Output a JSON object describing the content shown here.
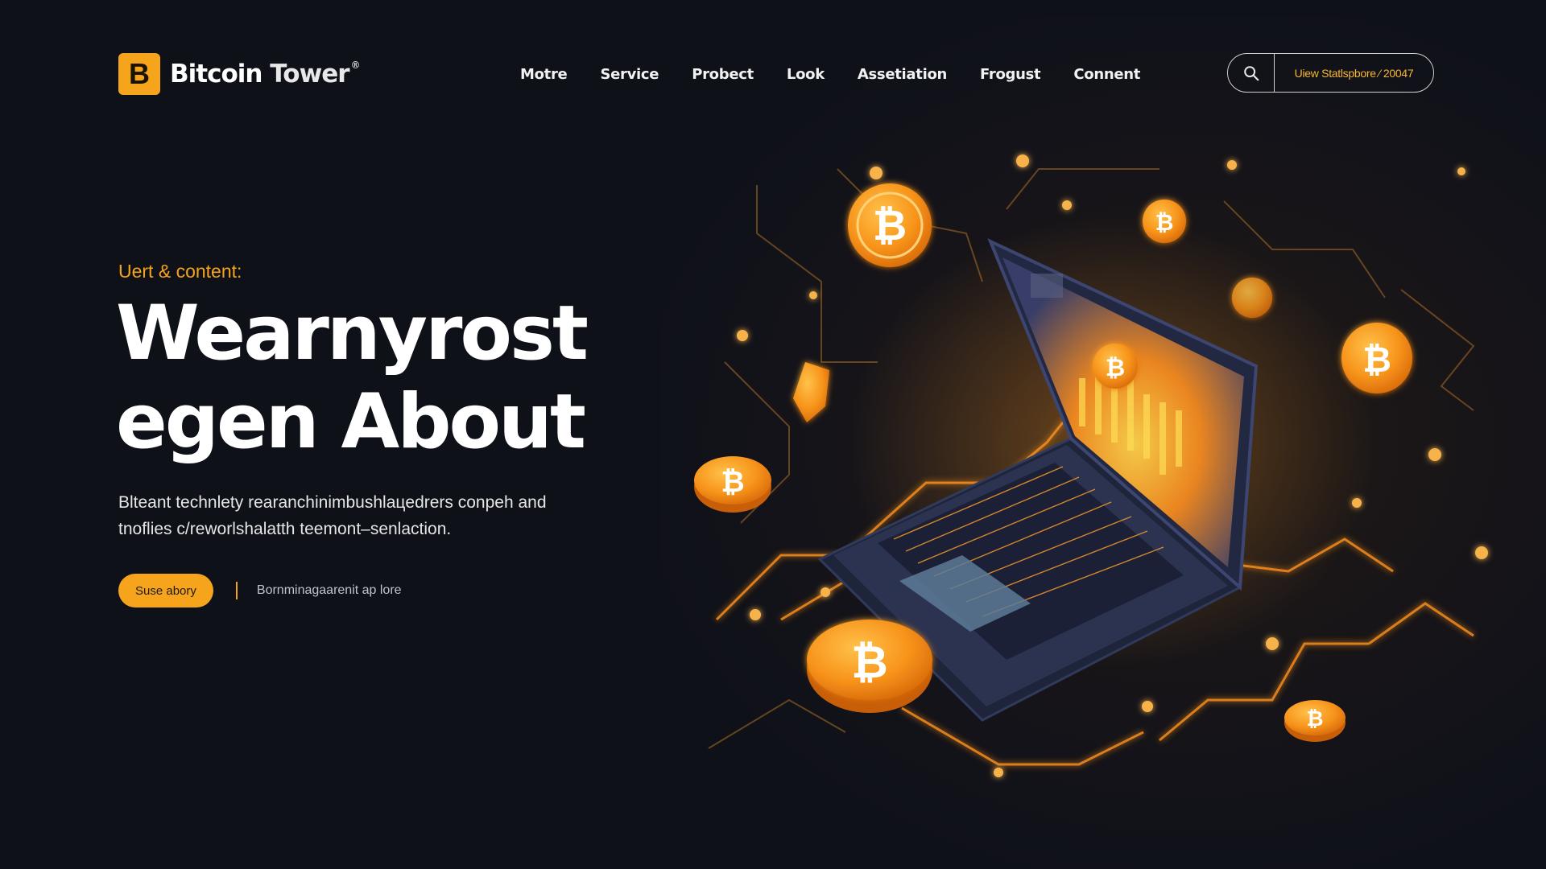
{
  "brand": {
    "mark": "B",
    "name_part1": "Bitcoin",
    "name_part2": "Tower",
    "registered": "®"
  },
  "nav": {
    "items": [
      "Motre",
      "Service",
      "Probect",
      "Look",
      "Assetiation",
      "Frogust",
      "Connent"
    ]
  },
  "search": {
    "icon": "search-icon",
    "text": "Uiew Statlspbore ⁄ 20047"
  },
  "hero": {
    "eyebrow": "Uert & content:",
    "headline_line1": "Wearnyrost",
    "headline_line2": "egen About",
    "description": "Blteant technlety rearanchinimbushlaцedrers conpeh and tnoflies c/reworlshalatth teemont–senlaction.",
    "cta_primary": "Suse abory",
    "cta_secondary": "Bornminagaarenit ap lore"
  },
  "colors": {
    "accent": "#f7a41d",
    "background": "#0f1119",
    "laptop_body": "#2b3350",
    "circuit": "#f08a1c"
  },
  "illustration": {
    "laptop_icon": "laptop-icon",
    "coin_icon": "bitcoin-coin-icon",
    "coin_symbol": "₿"
  }
}
